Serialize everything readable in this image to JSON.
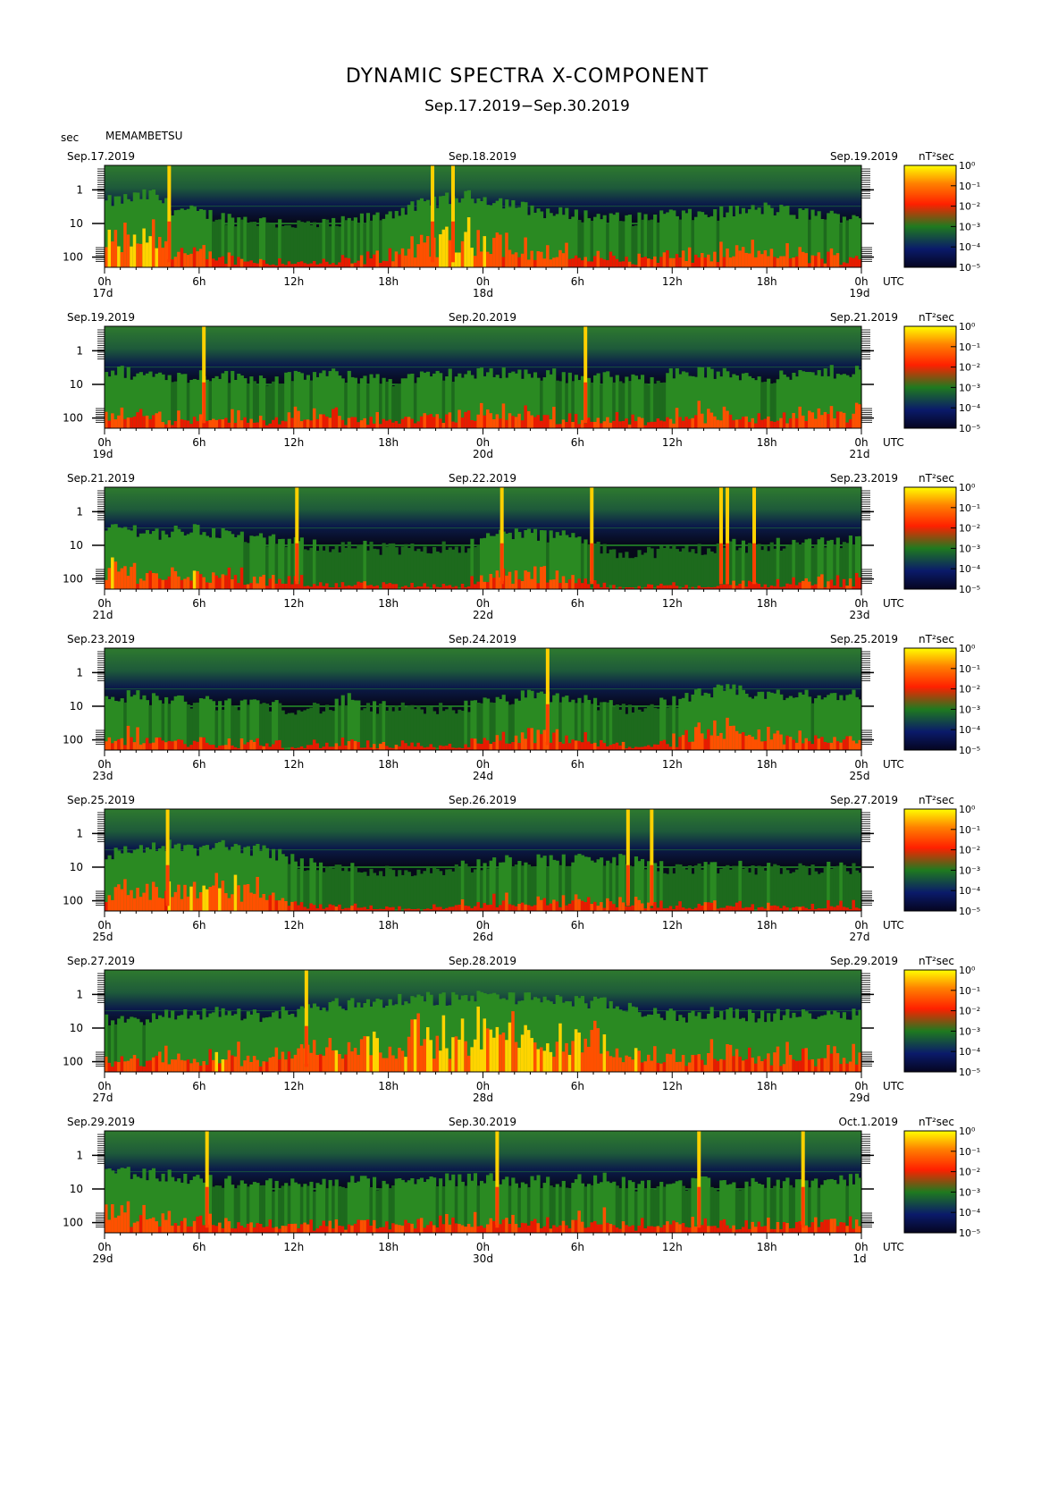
{
  "header": {
    "title": "DYNAMIC SPECTRA X-COMPONENT",
    "subtitle": "Sep.17.2019−Sep.30.2019",
    "unit_label": "sec",
    "station": "MEMAMBETSU"
  },
  "colors": {
    "background": "#ffffff",
    "frame": "#000000",
    "low": "#0a0a2a",
    "mid": "#1f7a1f",
    "high": "#ff2000",
    "peak": "#ffff00"
  },
  "chart_data": [
    {
      "type": "heatmap",
      "date_left": "Sep.17.2019",
      "date_mid": "Sep.18.2019",
      "date_right": "Sep.19.2019",
      "day_start": "17d",
      "day_mid": "18d",
      "day_end": "19d",
      "y_ticks": [
        "1",
        "10",
        "100"
      ],
      "x_ticks": [
        "0h",
        "6h",
        "12h",
        "18h",
        "0h",
        "6h",
        "12h",
        "18h",
        "0h"
      ],
      "utc_label": "UTC",
      "colorbar_unit": "nT²sec",
      "colorbar_ticks": [
        "10⁰",
        "10⁻¹",
        "10⁻²",
        "10⁻³",
        "10⁻⁴",
        "10⁻⁵"
      ],
      "spike_hours": [
        4.1,
        20.8,
        22.1
      ],
      "activity_profile": [
        0.7,
        0.75,
        0.8,
        0.85,
        0.6,
        0.55,
        0.5,
        0.45,
        0.4,
        0.4,
        0.35,
        0.35,
        0.3,
        0.3,
        0.3,
        0.35,
        0.4,
        0.45,
        0.55,
        0.6,
        0.7,
        0.75,
        0.8,
        0.8,
        0.75,
        0.7,
        0.6,
        0.55,
        0.5,
        0.5,
        0.45,
        0.45,
        0.4,
        0.4,
        0.45,
        0.5,
        0.45,
        0.5,
        0.5,
        0.55,
        0.55,
        0.6,
        0.55,
        0.5,
        0.5,
        0.45,
        0.45,
        0.5
      ]
    },
    {
      "type": "heatmap",
      "date_left": "Sep.19.2019",
      "date_mid": "Sep.20.2019",
      "date_right": "Sep.21.2019",
      "day_start": "19d",
      "day_mid": "20d",
      "day_end": "21d",
      "y_ticks": [
        "1",
        "10",
        "100"
      ],
      "x_ticks": [
        "0h",
        "6h",
        "12h",
        "18h",
        "0h",
        "6h",
        "12h",
        "18h",
        "0h"
      ],
      "utc_label": "UTC",
      "colorbar_unit": "nT²sec",
      "colorbar_ticks": [
        "10⁰",
        "10⁻¹",
        "10⁻²",
        "10⁻³",
        "10⁻⁴",
        "10⁻⁵"
      ],
      "spike_hours": [
        6.3,
        30.5
      ],
      "activity_profile": [
        0.55,
        0.55,
        0.5,
        0.5,
        0.5,
        0.45,
        0.5,
        0.5,
        0.45,
        0.45,
        0.4,
        0.45,
        0.45,
        0.5,
        0.5,
        0.45,
        0.45,
        0.4,
        0.4,
        0.45,
        0.45,
        0.5,
        0.5,
        0.5,
        0.55,
        0.55,
        0.5,
        0.5,
        0.5,
        0.45,
        0.45,
        0.45,
        0.4,
        0.4,
        0.45,
        0.5,
        0.55,
        0.55,
        0.5,
        0.5,
        0.5,
        0.45,
        0.45,
        0.5,
        0.5,
        0.55,
        0.55,
        0.6
      ]
    },
    {
      "type": "heatmap",
      "date_left": "Sep.21.2019",
      "date_mid": "Sep.22.2019",
      "date_right": "Sep.23.2019",
      "day_start": "21d",
      "day_mid": "22d",
      "day_end": "23d",
      "y_ticks": [
        "1",
        "10",
        "100"
      ],
      "x_ticks": [
        "0h",
        "6h",
        "12h",
        "18h",
        "0h",
        "6h",
        "12h",
        "18h",
        "0h"
      ],
      "utc_label": "UTC",
      "colorbar_unit": "nT²sec",
      "colorbar_ticks": [
        "10⁰",
        "10⁻¹",
        "10⁻²",
        "10⁻³",
        "10⁻⁴",
        "10⁻⁵"
      ],
      "spike_hours": [
        12.2,
        25.2,
        30.9,
        39.1,
        39.5,
        41.2
      ],
      "activity_profile": [
        0.6,
        0.65,
        0.6,
        0.55,
        0.55,
        0.6,
        0.6,
        0.55,
        0.5,
        0.45,
        0.4,
        0.4,
        0.35,
        0.35,
        0.3,
        0.3,
        0.3,
        0.25,
        0.25,
        0.25,
        0.3,
        0.3,
        0.3,
        0.35,
        0.5,
        0.55,
        0.55,
        0.5,
        0.5,
        0.5,
        0.3,
        0.25,
        0.2,
        0.2,
        0.2,
        0.25,
        0.25,
        0.25,
        0.3,
        0.35,
        0.3,
        0.3,
        0.35,
        0.35,
        0.4,
        0.4,
        0.4,
        0.45
      ]
    },
    {
      "type": "heatmap",
      "date_left": "Sep.23.2019",
      "date_mid": "Sep.24.2019",
      "date_right": "Sep.25.2019",
      "day_start": "23d",
      "day_mid": "24d",
      "day_end": "25d",
      "y_ticks": [
        "1",
        "10",
        "100"
      ],
      "x_ticks": [
        "0h",
        "6h",
        "12h",
        "18h",
        "0h",
        "6h",
        "12h",
        "18h",
        "0h"
      ],
      "utc_label": "UTC",
      "colorbar_unit": "nT²sec",
      "colorbar_ticks": [
        "10⁰",
        "10⁻¹",
        "10⁻²",
        "10⁻³",
        "10⁻⁴",
        "10⁻⁵"
      ],
      "spike_hours": [
        28.1
      ],
      "activity_profile": [
        0.55,
        0.5,
        0.5,
        0.45,
        0.45,
        0.4,
        0.4,
        0.35,
        0.35,
        0.4,
        0.35,
        0.3,
        0.3,
        0.3,
        0.3,
        0.45,
        0.3,
        0.3,
        0.3,
        0.25,
        0.25,
        0.3,
        0.3,
        0.35,
        0.4,
        0.45,
        0.5,
        0.5,
        0.5,
        0.45,
        0.4,
        0.35,
        0.3,
        0.3,
        0.35,
        0.4,
        0.45,
        0.55,
        0.6,
        0.6,
        0.55,
        0.55,
        0.5,
        0.5,
        0.5,
        0.5,
        0.55,
        0.5
      ]
    },
    {
      "type": "heatmap",
      "date_left": "Sep.25.2019",
      "date_mid": "Sep.26.2019",
      "date_right": "Sep.27.2019",
      "day_start": "25d",
      "day_mid": "26d",
      "day_end": "27d",
      "y_ticks": [
        "1",
        "10",
        "100"
      ],
      "x_ticks": [
        "0h",
        "6h",
        "12h",
        "18h",
        "0h",
        "6h",
        "12h",
        "18h",
        "0h"
      ],
      "utc_label": "UTC",
      "colorbar_unit": "nT²sec",
      "colorbar_ticks": [
        "10⁰",
        "10⁻¹",
        "10⁻²",
        "10⁻³",
        "10⁻⁴",
        "10⁻⁵"
      ],
      "spike_hours": [
        4.0,
        33.2,
        34.7
      ],
      "activity_profile": [
        0.55,
        0.6,
        0.65,
        0.7,
        0.7,
        0.65,
        0.65,
        0.7,
        0.7,
        0.65,
        0.6,
        0.55,
        0.4,
        0.35,
        0.3,
        0.3,
        0.3,
        0.25,
        0.25,
        0.25,
        0.3,
        0.3,
        0.35,
        0.35,
        0.4,
        0.45,
        0.45,
        0.45,
        0.45,
        0.45,
        0.45,
        0.45,
        0.45,
        0.4,
        0.35,
        0.3,
        0.3,
        0.3,
        0.3,
        0.35,
        0.3,
        0.3,
        0.3,
        0.3,
        0.3,
        0.3,
        0.3,
        0.35
      ]
    },
    {
      "type": "heatmap",
      "date_left": "Sep.27.2019",
      "date_mid": "Sep.28.2019",
      "date_right": "Sep.29.2019",
      "day_start": "27d",
      "day_mid": "28d",
      "day_end": "29d",
      "y_ticks": [
        "1",
        "10",
        "100"
      ],
      "x_ticks": [
        "0h",
        "6h",
        "12h",
        "18h",
        "0h",
        "6h",
        "12h",
        "18h",
        "0h"
      ],
      "utc_label": "UTC",
      "colorbar_unit": "nT²sec",
      "colorbar_ticks": [
        "10⁰",
        "10⁻¹",
        "10⁻²",
        "10⁻³",
        "10⁻⁴",
        "10⁻⁵"
      ],
      "spike_hours": [
        12.8
      ],
      "activity_profile": [
        0.45,
        0.45,
        0.5,
        0.5,
        0.55,
        0.55,
        0.6,
        0.6,
        0.6,
        0.55,
        0.55,
        0.6,
        0.65,
        0.7,
        0.75,
        0.75,
        0.8,
        0.8,
        0.8,
        0.85,
        0.85,
        0.85,
        0.85,
        0.9,
        0.9,
        0.9,
        0.85,
        0.85,
        0.85,
        0.8,
        0.8,
        0.75,
        0.7,
        0.65,
        0.6,
        0.55,
        0.55,
        0.55,
        0.6,
        0.6,
        0.55,
        0.55,
        0.55,
        0.55,
        0.6,
        0.6,
        0.6,
        0.6
      ]
    },
    {
      "type": "heatmap",
      "date_left": "Sep.29.2019",
      "date_mid": "Sep.30.2019",
      "date_right": "Oct.1.2019",
      "day_start": "29d",
      "day_mid": "30d",
      "day_end": "1d",
      "y_ticks": [
        "1",
        "10",
        "100"
      ],
      "x_ticks": [
        "0h",
        "6h",
        "12h",
        "18h",
        "0h",
        "6h",
        "12h",
        "18h",
        "0h"
      ],
      "utc_label": "UTC",
      "colorbar_unit": "nT²sec",
      "colorbar_ticks": [
        "10⁰",
        "10⁻¹",
        "10⁻²",
        "10⁻³",
        "10⁻⁴",
        "10⁻⁵"
      ],
      "spike_hours": [
        6.5,
        24.9,
        37.7,
        44.3
      ],
      "activity_profile": [
        0.7,
        0.65,
        0.6,
        0.6,
        0.55,
        0.5,
        0.5,
        0.45,
        0.45,
        0.45,
        0.4,
        0.4,
        0.4,
        0.4,
        0.4,
        0.45,
        0.45,
        0.4,
        0.4,
        0.45,
        0.45,
        0.5,
        0.5,
        0.5,
        0.5,
        0.5,
        0.45,
        0.45,
        0.45,
        0.45,
        0.5,
        0.5,
        0.45,
        0.4,
        0.4,
        0.4,
        0.4,
        0.45,
        0.4,
        0.4,
        0.4,
        0.45,
        0.45,
        0.45,
        0.45,
        0.5,
        0.5,
        0.5
      ]
    }
  ]
}
